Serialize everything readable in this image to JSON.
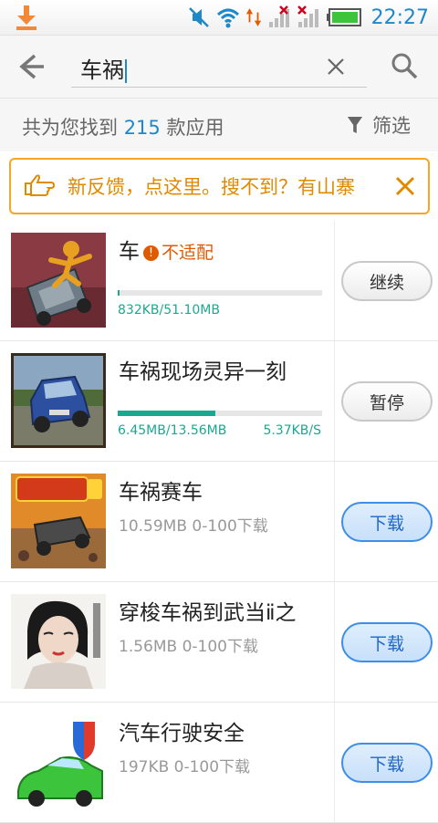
{
  "status_bar": {
    "time": "22:27",
    "icons": [
      "download-icon",
      "mute-icon",
      "wifi-icon",
      "data-arrows-icon",
      "signal-icon",
      "signal-icon-2",
      "battery-icon"
    ]
  },
  "search": {
    "query": "车祸"
  },
  "results": {
    "prefix": "共为您找到",
    "count": "215",
    "suffix": "款应用",
    "filter_label": "筛选"
  },
  "banner": {
    "text": "新反馈，点这里。搜不到？有山寨"
  },
  "apps": [
    {
      "name": "车",
      "warning": "不适配",
      "size_progress": "832KB/51.10MB",
      "progress": 0.01,
      "button": "继续",
      "button_style": "gray"
    },
    {
      "name": "车祸现场灵异一刻",
      "size_progress": "6.45MB/13.56MB",
      "speed": "5.37KB/S",
      "progress": 0.476,
      "button": "暂停",
      "button_style": "gray"
    },
    {
      "name": "车祸赛车",
      "meta": "10.59MB  0-100下载",
      "button": "下载",
      "button_style": "blue"
    },
    {
      "name": "穿梭车祸到武当ⅱ之",
      "meta": "1.56MB  0-100下载",
      "button": "下载",
      "button_style": "blue"
    },
    {
      "name": "汽车行驶安全",
      "meta": "197KB  0-100下载",
      "button": "下载",
      "button_style": "blue"
    }
  ],
  "colors": {
    "accent": "#1e88c8",
    "progress": "#1aa891",
    "banner": "#f5a623",
    "download_button": "#3e8ee6"
  }
}
